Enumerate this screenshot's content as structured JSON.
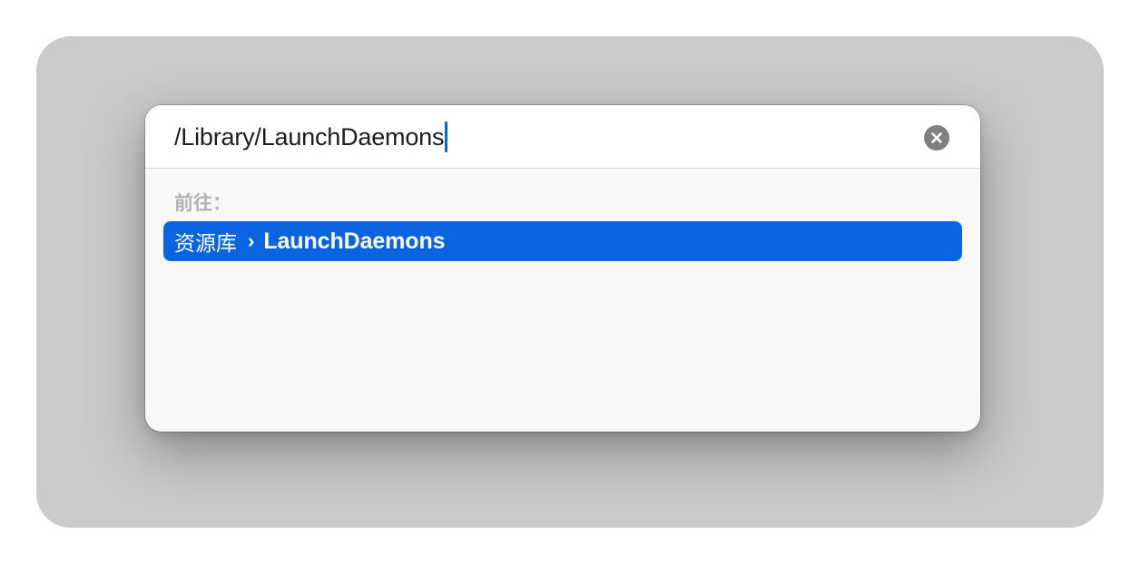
{
  "dialog": {
    "path_value": "/Library/LaunchDaemons",
    "clear_icon": "xmark-circle-icon",
    "section_label": "前往：",
    "result": {
      "parent": "资源库",
      "separator": "›",
      "target": "LaunchDaemons"
    }
  },
  "colors": {
    "accent": "#0a64e0",
    "backdrop": "#cbcbcb"
  }
}
